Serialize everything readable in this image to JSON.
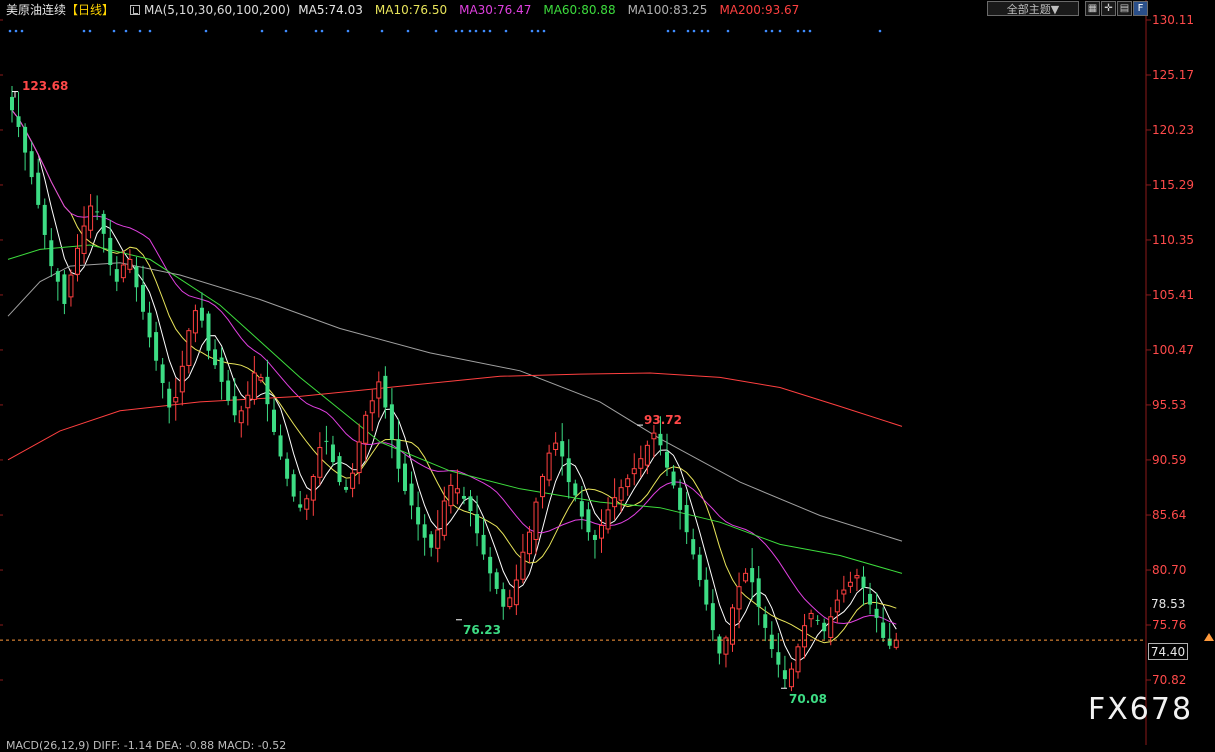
{
  "header": {
    "symbol": "美原油连续",
    "period": "【日线】",
    "ma_params": "MA(5,10,30,60,100,200)",
    "ma5": "MA5:74.03",
    "ma10": "MA10:76.50",
    "ma30": "MA30:76.47",
    "ma60": "MA60:80.88",
    "ma100": "MA100:83.25",
    "ma200": "MA200:93.67"
  },
  "toolbar": {
    "theme_select": "全部主题▼",
    "icons": [
      "grid-icon",
      "crosshair-icon",
      "table-icon",
      "fund-icon"
    ]
  },
  "annotations": {
    "high": "123.68",
    "swing_high": "93.72",
    "swing_low": "76.23",
    "low": "70.08"
  },
  "price_axis": {
    "last_price": "74.40",
    "ma_marker": "78.53"
  },
  "watermark": "FX678",
  "macd_label": "MACD(26,12,9)  DIFF: -1.14  DEA: -0.88  MACD: -0.52",
  "colors": {
    "up": "#ff4040",
    "down": "#3ddc84",
    "ma5": "#ffffff",
    "ma10": "#e8e45a",
    "ma30": "#e040e0",
    "ma60": "#3ddc3d",
    "ma100": "#a0a0a0",
    "ma200": "#ff4040",
    "last_line": "#ff9a3c"
  },
  "chart_data": {
    "type": "candlestick",
    "y_ticks": [
      130.11,
      125.17,
      120.23,
      115.29,
      110.35,
      105.41,
      100.47,
      95.53,
      90.59,
      85.64,
      80.7,
      75.76,
      70.82
    ],
    "y_range": [
      69.5,
      130.11
    ],
    "closes": [
      122.0,
      120.5,
      118.2,
      116.0,
      113.5,
      110.8,
      108.0,
      106.6,
      104.6,
      107.2,
      109.6,
      111.6,
      113.4,
      112.9,
      110.9,
      108.1,
      106.6,
      108.1,
      108.6,
      106.1,
      103.9,
      101.6,
      99.5,
      97.5,
      95.3,
      96.2,
      99.0,
      102.2,
      104.0,
      103.1,
      100.4,
      99.1,
      97.6,
      95.9,
      94.6,
      95.0,
      96.4,
      98.4,
      98.0,
      95.6,
      93.1,
      90.9,
      88.9,
      87.3,
      86.3,
      87.1,
      89.1,
      91.7,
      92.3,
      90.4,
      88.6,
      87.9,
      89.4,
      92.2,
      94.6,
      95.9,
      97.6,
      95.3,
      92.4,
      89.8,
      87.8,
      86.5,
      84.8,
      83.6,
      82.7,
      84.3,
      86.9,
      88.3,
      88.0,
      87.1,
      86.0,
      84.0,
      82.1,
      80.4,
      79.0,
      77.4,
      78.2,
      79.8,
      82.3,
      84.1,
      86.8,
      89.1,
      91.2,
      92.1,
      90.9,
      88.6,
      87.4,
      85.5,
      84.1,
      83.4,
      84.7,
      86.1,
      87.2,
      88.1,
      88.9,
      89.8,
      90.7,
      91.9,
      93.0,
      91.9,
      89.9,
      88.3,
      86.1,
      84.1,
      82.1,
      79.8,
      77.6,
      75.3,
      73.2,
      74.6,
      77.3,
      79.2,
      80.4,
      79.6,
      77.4,
      75.5,
      73.6,
      72.2,
      70.9,
      71.8,
      73.8,
      75.7,
      76.8,
      76.2,
      75.2,
      76.5,
      78.0,
      78.9,
      79.6,
      80.2,
      79.1,
      77.6,
      76.4,
      74.6,
      73.9,
      74.4
    ]
  }
}
